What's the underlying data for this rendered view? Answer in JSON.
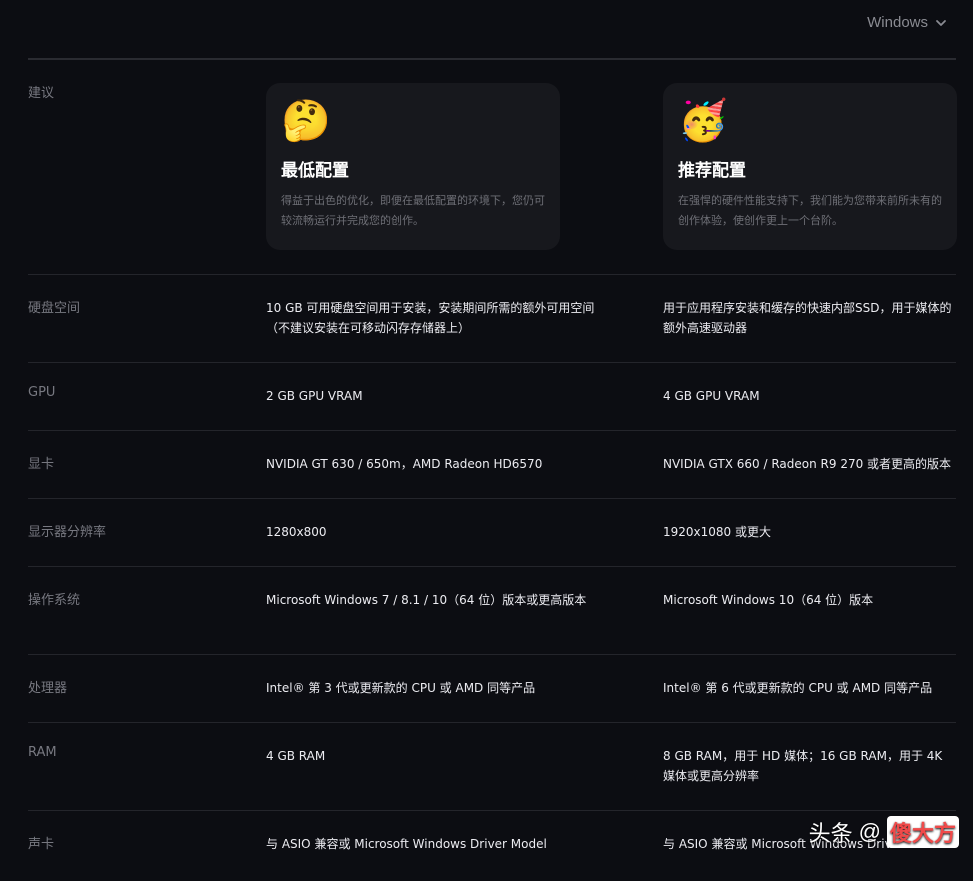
{
  "os_selector": {
    "value": "Windows"
  },
  "header": {
    "label": "建议",
    "min_card": {
      "emoji": "🤔",
      "title": "最低配置",
      "desc": "得益于出色的优化，即便在最低配置的环境下，您仍可较流畅运行并完成您的创作。"
    },
    "rec_card": {
      "emoji": "🥳",
      "title": "推荐配置",
      "desc": "在强悍的硬件性能支持下，我们能为您带来前所未有的创作体验，使创作更上一个台阶。"
    }
  },
  "rows": {
    "disk": {
      "label": "硬盘空间",
      "min": "10 GB 可用硬盘空间用于安装，安装期间所需的额外可用空间（不建议安装在可移动闪存存储器上）",
      "rec": "用于应用程序安装和缓存的快速内部SSD，用于媒体的额外高速驱动器"
    },
    "gpu": {
      "label": "GPU",
      "min": "2 GB GPU VRAM",
      "rec": "4 GB GPU VRAM"
    },
    "card": {
      "label": "显卡",
      "min": "NVIDIA GT 630 / 650m，AMD Radeon HD6570",
      "rec": "NVIDIA GTX 660 / Radeon R9 270 或者更高的版本"
    },
    "res": {
      "label": "显示器分辨率",
      "min": "1280x800",
      "rec": "1920x1080 或更大"
    },
    "os": {
      "label": "操作系统",
      "min": "Microsoft Windows 7 / 8.1 / 10（64 位）版本或更高版本",
      "rec": "Microsoft Windows 10（64 位）版本"
    },
    "cpu": {
      "label": "处理器",
      "min": "Intel® 第 3 代或更新款的 CPU 或 AMD 同等产品",
      "rec": "Intel® 第 6 代或更新款的 CPU 或 AMD 同等产品"
    },
    "ram": {
      "label": "RAM",
      "min": "4 GB RAM",
      "rec": "8 GB RAM，用于 HD 媒体；16 GB RAM，用于 4K 媒体或更高分辨率"
    },
    "snd": {
      "label": "声卡",
      "min": "与 ASIO 兼容或 Microsoft Windows Driver Model",
      "rec": "与 ASIO 兼容或 Microsoft Windows Driver"
    }
  },
  "watermark": {
    "prefix": "头条",
    "at": "@",
    "name": "傻大方"
  }
}
